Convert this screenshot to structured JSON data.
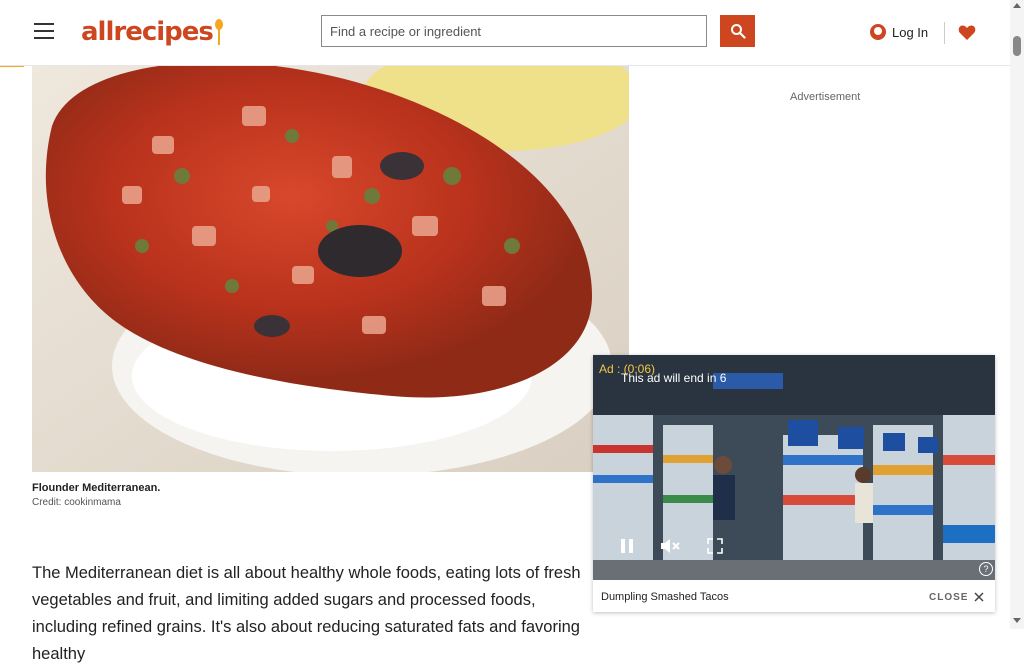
{
  "header": {
    "logo_text": "allrecipes",
    "search_placeholder": "Find a recipe or ingredient",
    "login_label": "Log In"
  },
  "main": {
    "image_caption_title": "Flounder Mediterranean.",
    "image_caption_credit": "Credit: cookinmama",
    "advertisement_label": "Advertisement",
    "article_paragraph": "The Mediterranean diet is all about healthy whole foods, eating lots of fresh vegetables and fruit, and limiting added sugars and processed foods, including refined grains. It's also about reducing saturated fats and favoring healthy"
  },
  "video_ad": {
    "timer": "Ad : (0:06)",
    "end_notice": "This ad will end in 6",
    "title": "Dumpling Smashed Tacos",
    "close_label": "CLOSE",
    "help_glyph": "?"
  },
  "colors": {
    "brand": "#ce4620",
    "accent": "#f5a623"
  }
}
